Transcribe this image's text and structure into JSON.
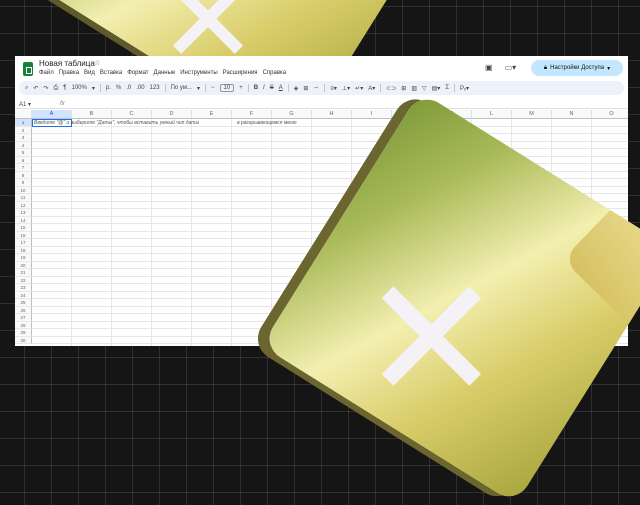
{
  "app": {
    "title": "Новая таблица",
    "menu": [
      "Файл",
      "Правка",
      "Вид",
      "Вставка",
      "Формат",
      "Данные",
      "Инструменты",
      "Расширения",
      "Справка"
    ],
    "share_label": "Настройки Доступа"
  },
  "toolbar": {
    "zoom": "100%",
    "currency": "р.",
    "percent": "%",
    "decrease_decimals": ".0",
    "increase_decimals": ".00",
    "number_format": "123",
    "font": "По ум...",
    "font_size": "10"
  },
  "formula_bar": {
    "cell_ref": "A1",
    "fx_label": "fx"
  },
  "columns": [
    "A",
    "B",
    "C",
    "D",
    "E",
    "F",
    "G",
    "H",
    "I",
    "J",
    "K",
    "L",
    "M",
    "N",
    "O"
  ],
  "row_count": 30,
  "cell_hint": {
    "text": "Введите \"@\" и выберите \"Даты\", чтобы вставить умный чип даты",
    "text_tail": "в раскрывающемся меню"
  },
  "colors": {
    "accent": "#1a73e8",
    "share_button": "#c2e7ff",
    "sheets_green": "#188038"
  }
}
